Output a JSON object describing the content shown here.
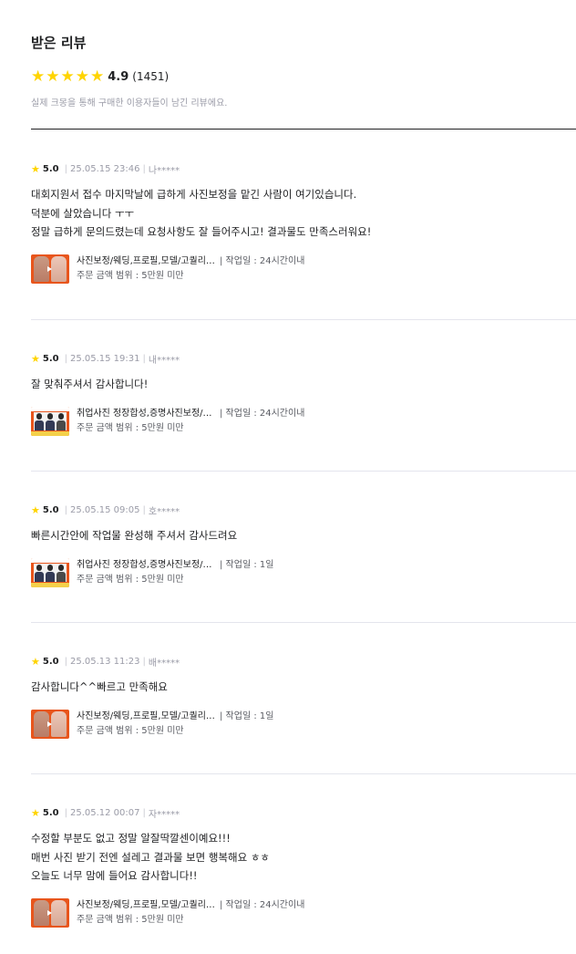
{
  "header": {
    "title": "받은 리뷰",
    "rating": "4.9",
    "count": "(1451)",
    "notice": "실제 크몽을 통해 구매한 이용자들이 남긴 리뷰에요."
  },
  "colors": {
    "star": "#ffd400",
    "text": "#212224",
    "muted": "#9a9ba7",
    "thumb_accent": "#e8551c"
  },
  "reviews": [
    {
      "score": "5.0",
      "date": "25.05.15 23:46",
      "user": "나*****",
      "lines": [
        "대회지원서 접수 마지막날에 급하게 사진보정을 맡긴 사람이 여기있습니다.",
        "덕분에 살았습니다 ㅜㅜ",
        "정말 급하게 문의드렸는데 요청사항도 잘 들어주시고! 결과물도 만족스러워요!"
      ],
      "product": "사진보정/웨딩,프로필,모델/고퀄리티 보정",
      "work": "| 작업일 : 24시간이내",
      "price": "주문 금액 범위 : 5만원 미만",
      "thumb": "retouch"
    },
    {
      "score": "5.0",
      "date": "25.05.15 19:31",
      "user": "내*****",
      "lines": [
        "잘 맞춰주셔서 감사합니다!"
      ],
      "product": "취업사진 정장합성,증명사진보정/여권사진",
      "work": "| 작업일 : 24시간이내",
      "price": "주문 금액 범위 : 5만원 미만",
      "thumb": "id"
    },
    {
      "score": "5.0",
      "date": "25.05.15 09:05",
      "user": "호*****",
      "lines": [
        "빠른시간안에 작업물 완성해 주셔서 감사드려요"
      ],
      "product": "취업사진 정장합성,증명사진보정/여권사진",
      "work": "| 작업일 : 1일",
      "price": "주문 금액 범위 : 5만원 미만",
      "thumb": "id"
    },
    {
      "score": "5.0",
      "date": "25.05.13 11:23",
      "user": "배*****",
      "lines": [
        "감사합니다^^빠르고 만족해요"
      ],
      "product": "사진보정/웨딩,프로필,모델/고퀄리티 보정",
      "work": "| 작업일 : 1일",
      "price": "주문 금액 범위 : 5만원 미만",
      "thumb": "retouch"
    },
    {
      "score": "5.0",
      "date": "25.05.12 00:07",
      "user": "자*****",
      "lines": [
        "수정할 부분도 없고 정말 알잘딱깔센이예요!!!",
        "매번 사진 받기 전엔 설레고 결과물 보면 행복해요 ㅎㅎ",
        "오늘도 너무 맘에 들어요 감사합니다!!"
      ],
      "product": "사진보정/웨딩,프로필,모델/고퀄리티 보정",
      "work": "| 작업일 : 24시간이내",
      "price": "주문 금액 범위 : 5만원 미만",
      "thumb": "retouch"
    }
  ]
}
